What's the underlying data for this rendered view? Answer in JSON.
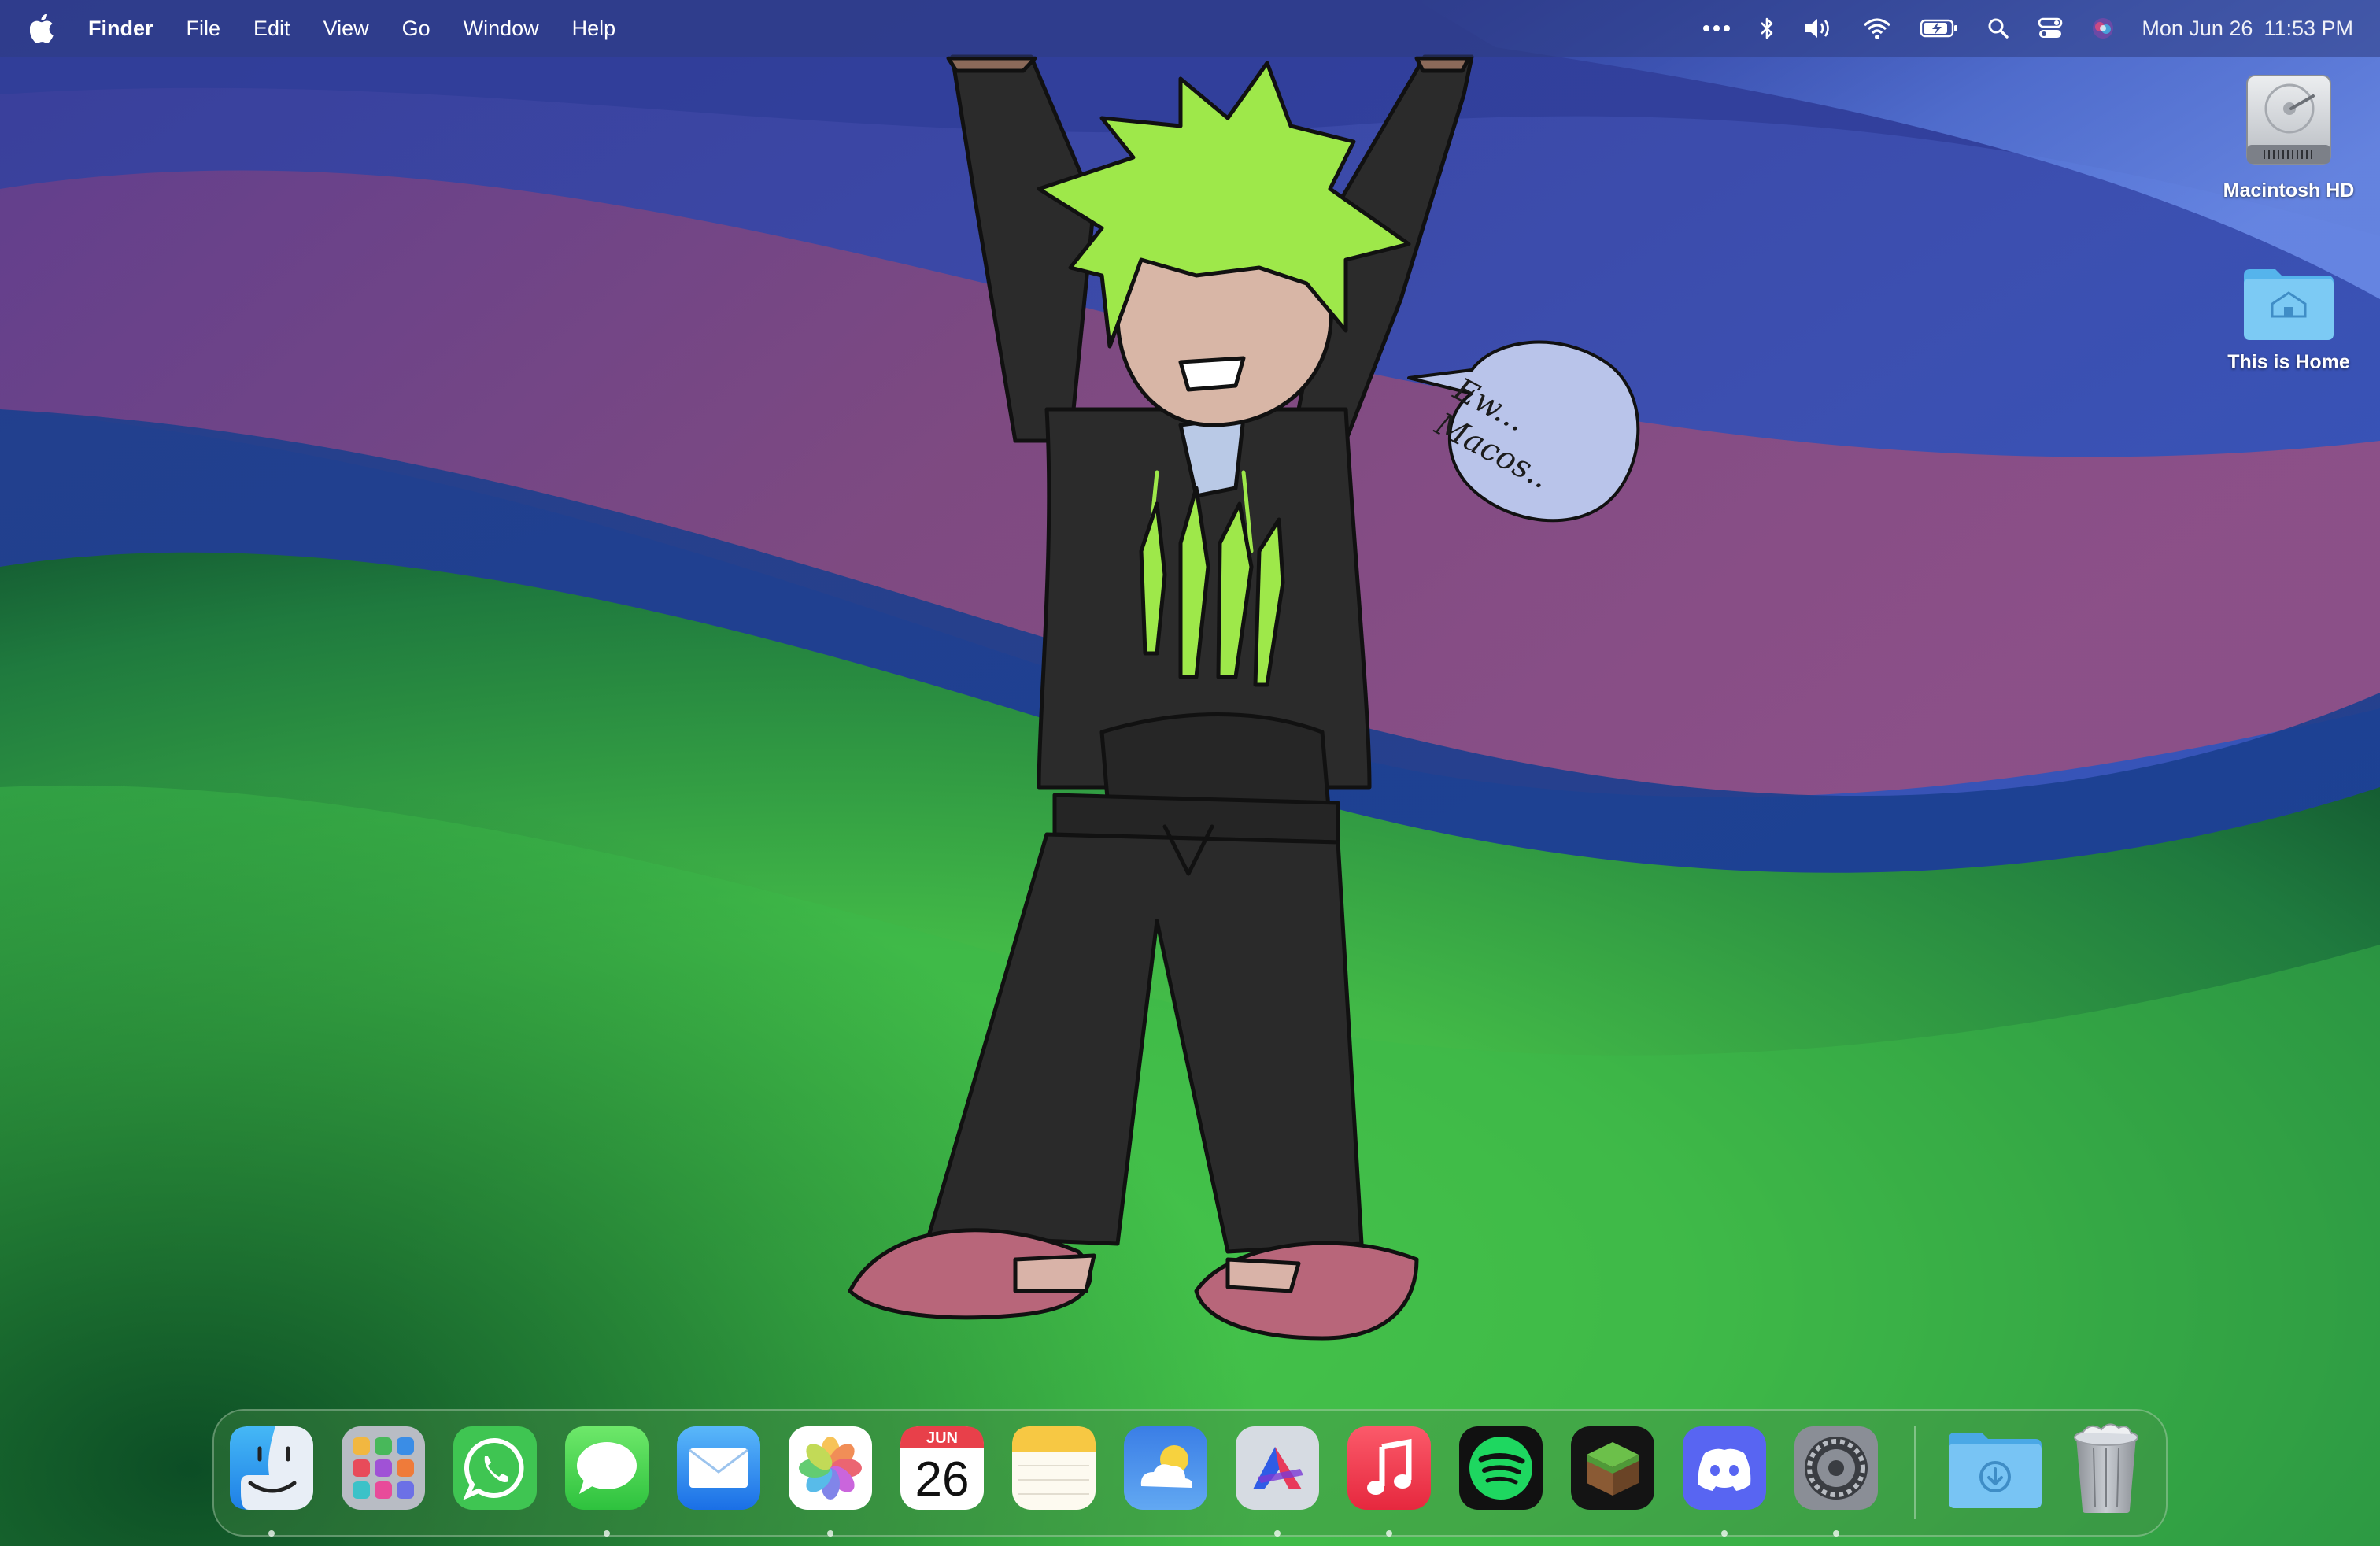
{
  "menubar": {
    "apple_icon": "apple-logo-icon",
    "app_name": "Finder",
    "menus": [
      "File",
      "Edit",
      "View",
      "Go",
      "Window",
      "Help"
    ],
    "status_icons": [
      "more-icon",
      "bluetooth-icon",
      "volume-icon",
      "wifi-icon",
      "battery-charging-icon",
      "spotlight-search-icon",
      "control-center-icon",
      "siri-icon"
    ],
    "date": "Mon Jun 26",
    "time": "11:53 PM"
  },
  "desktop": {
    "icons": [
      {
        "label": "Macintosh HD",
        "icon": "hard-drive-icon"
      },
      {
        "label": "This is Home",
        "icon": "home-folder-icon"
      }
    ],
    "speech_bubble": {
      "line1": "Ew...",
      "line2": "Macos.."
    }
  },
  "dock": {
    "apps": [
      {
        "name": "Finder",
        "icon": "finder-icon",
        "running": true
      },
      {
        "name": "Launchpad",
        "icon": "launchpad-icon",
        "running": false
      },
      {
        "name": "WhatsApp",
        "icon": "whatsapp-icon",
        "running": false
      },
      {
        "name": "Messages",
        "icon": "messages-icon",
        "running": true
      },
      {
        "name": "Mail",
        "icon": "mail-icon",
        "running": false
      },
      {
        "name": "Photos",
        "icon": "photos-icon",
        "running": true
      },
      {
        "name": "Calendar",
        "icon": "calendar-icon",
        "running": false
      },
      {
        "name": "Notes",
        "icon": "notes-icon",
        "running": false
      },
      {
        "name": "Weather",
        "icon": "weather-icon",
        "running": false
      },
      {
        "name": "Affinity",
        "icon": "affinity-icon",
        "running": true
      },
      {
        "name": "Music",
        "icon": "music-icon",
        "running": true
      },
      {
        "name": "Spotify",
        "icon": "spotify-icon",
        "running": false
      },
      {
        "name": "Minecraft",
        "icon": "minecraft-icon",
        "running": false
      },
      {
        "name": "Discord",
        "icon": "discord-icon",
        "running": true
      },
      {
        "name": "System Settings",
        "icon": "settings-gear-icon",
        "running": true
      }
    ],
    "calendar": {
      "month": "JUN",
      "day": "26"
    },
    "stack": {
      "name": "Downloads",
      "icon": "downloads-folder-icon"
    },
    "trash": {
      "name": "Trash",
      "icon": "trash-icon"
    }
  }
}
